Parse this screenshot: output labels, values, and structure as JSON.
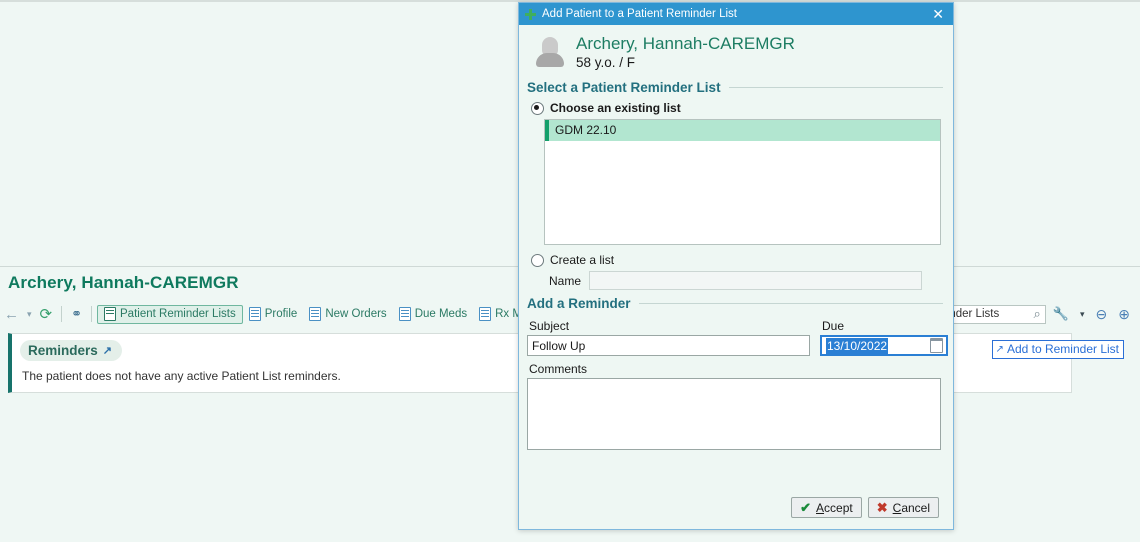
{
  "background": {
    "patient_banner_title": "Archery, Hannah-CAREMGR",
    "toolbar": {
      "icons": [
        {
          "name": "back-arrow-icon",
          "glyph": "←"
        },
        {
          "name": "history-dropdown-icon",
          "glyph": "▾"
        },
        {
          "name": "refresh-icon",
          "glyph": "⟳"
        },
        {
          "name": "binoculars-icon",
          "glyph": "♁"
        }
      ],
      "tabs": [
        {
          "label": "Patient Reminder Lists",
          "active": true
        },
        {
          "label": "Profile",
          "active": false
        },
        {
          "label": "New Orders",
          "active": false
        },
        {
          "label": "Due Meds",
          "active": false
        },
        {
          "label": "Rx Messages",
          "active": false
        }
      ],
      "search_value": "eminder Lists",
      "right_icons": [
        {
          "name": "search-icon",
          "glyph": "⌕"
        },
        {
          "name": "wrench-icon",
          "glyph": "🔧"
        },
        {
          "name": "tools-dropdown-icon",
          "glyph": "▾"
        },
        {
          "name": "zoom-out-icon",
          "glyph": "⊖"
        },
        {
          "name": "zoom-in-icon",
          "glyph": "⊕"
        }
      ]
    },
    "reminders_panel": {
      "header": "Reminders",
      "header_icon": "expand-arrow-icon",
      "empty_text": "The patient does not have any active Patient List reminders."
    },
    "add_to_reminder_link": "Add to Reminder List"
  },
  "dialog": {
    "title": "Add Patient to a Patient Reminder List",
    "title_icon": "plus-icon",
    "close_label": "✕",
    "patient": {
      "name": "Archery, Hannah-CAREMGR",
      "demographics": "58 y.o. / F"
    },
    "select_section": {
      "heading": "Select a Patient Reminder List",
      "existing_radio_label": "Choose an existing list",
      "existing_selected": true,
      "list_items": [
        "GDM 22.10"
      ],
      "selected_list_item": "GDM 22.10",
      "create_radio_label": "Create a list",
      "create_selected": false,
      "name_label": "Name",
      "name_value": ""
    },
    "reminder_section": {
      "heading": "Add a Reminder",
      "subject_label": "Subject",
      "subject_value": "Follow Up",
      "due_label": "Due",
      "due_value": "13/10/2022",
      "comments_label": "Comments",
      "comments_value": ""
    },
    "buttons": {
      "accept": "Accept",
      "accept_accel": "A",
      "cancel": "Cancel",
      "cancel_accel": "C"
    }
  }
}
